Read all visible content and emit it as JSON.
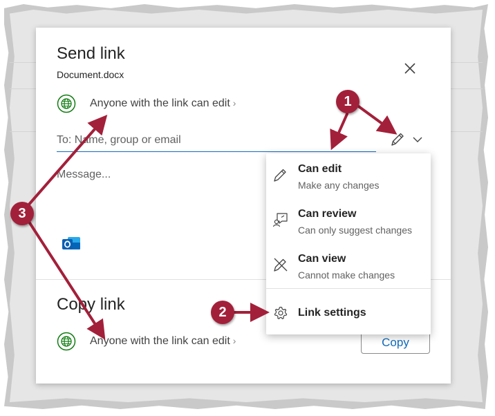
{
  "dialog": {
    "title": "Send link",
    "filename": "Document.docx",
    "permission_text": "Anyone with the link can edit",
    "permission_chevron": "›",
    "to_placeholder": "To: Name, group or email",
    "message_placeholder": "Message...",
    "copy_title": "Copy link",
    "copy_permission_text": "Anyone with the link can edit",
    "copy_button": "Copy"
  },
  "menu": {
    "items": [
      {
        "label": "Can edit",
        "description": "Make any changes",
        "icon": "pencil-icon"
      },
      {
        "label": "Can review",
        "description": "Can only suggest changes",
        "icon": "review-icon"
      },
      {
        "label": "Can view",
        "description": "Cannot make changes",
        "icon": "no-edit-icon"
      }
    ],
    "settings_label": "Link settings",
    "settings_icon": "gear-icon"
  },
  "annotations": {
    "labels": [
      "1",
      "2",
      "3"
    ]
  },
  "colors": {
    "accent": "#0f6cbd",
    "annotation": "#a3203a",
    "globe": "#107c10"
  }
}
